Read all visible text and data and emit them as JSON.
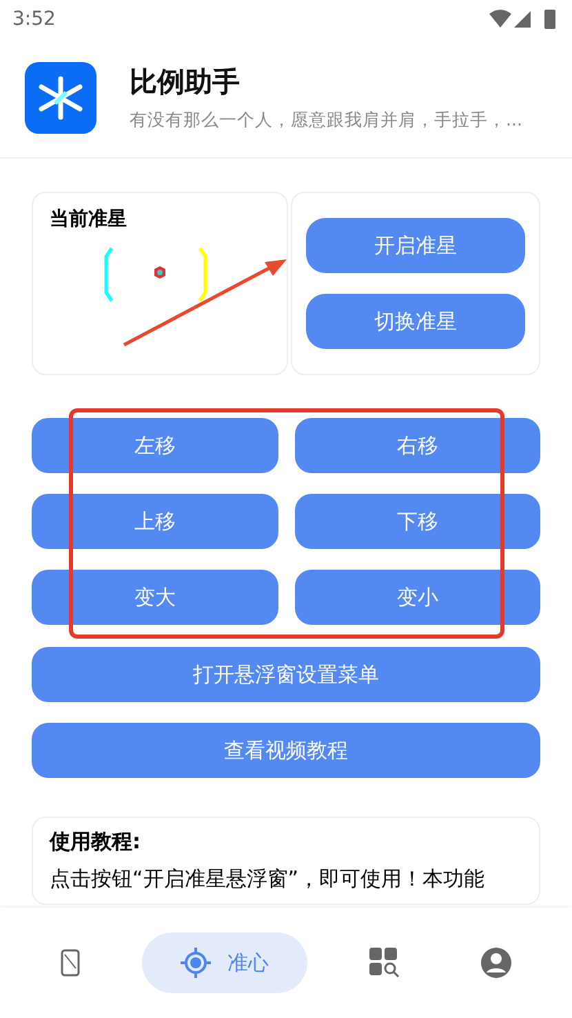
{
  "status_bar": {
    "time": "3:52"
  },
  "app": {
    "name": "比例助手",
    "tagline": "有没有那么一个人，愿意跟我肩并肩，手拉手，..."
  },
  "crosshair_card": {
    "title": "当前准星"
  },
  "crosshair_actions": [
    "开启准星",
    "切换准星"
  ],
  "move_buttons": [
    "左移",
    "右移",
    "上移",
    "下移",
    "变大",
    "变小"
  ],
  "wide_buttons": [
    "打开悬浮窗设置菜单",
    "查看视频教程"
  ],
  "tutorial": {
    "title": "使用教程:",
    "text": "点击按钮“开启准星悬浮窗”，即可使用！本功能"
  },
  "bottom_nav": [
    {
      "kind": "phone",
      "selected": false
    },
    {
      "kind": "crosshair",
      "label": "准心",
      "selected": true
    },
    {
      "kind": "apps",
      "selected": false
    },
    {
      "kind": "profile",
      "selected": false
    }
  ]
}
